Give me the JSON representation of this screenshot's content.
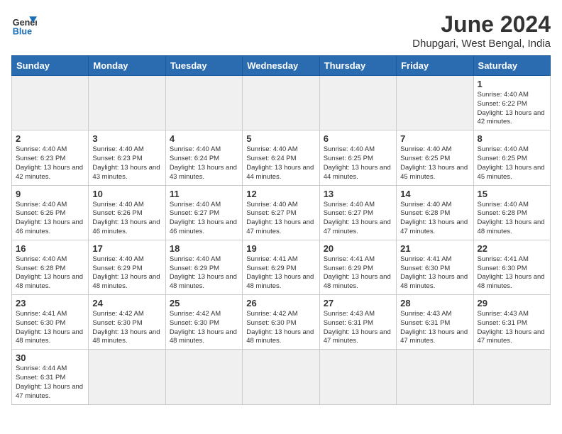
{
  "header": {
    "logo_general": "General",
    "logo_blue": "Blue",
    "month_title": "June 2024",
    "location": "Dhupgari, West Bengal, India"
  },
  "weekdays": [
    "Sunday",
    "Monday",
    "Tuesday",
    "Wednesday",
    "Thursday",
    "Friday",
    "Saturday"
  ],
  "weeks": [
    [
      {
        "day": "",
        "info": "",
        "empty": true
      },
      {
        "day": "",
        "info": "",
        "empty": true
      },
      {
        "day": "",
        "info": "",
        "empty": true
      },
      {
        "day": "",
        "info": "",
        "empty": true
      },
      {
        "day": "",
        "info": "",
        "empty": true
      },
      {
        "day": "",
        "info": "",
        "empty": true
      },
      {
        "day": "1",
        "info": "Sunrise: 4:40 AM\nSunset: 6:22 PM\nDaylight: 13 hours\nand 42 minutes.",
        "empty": false
      }
    ],
    [
      {
        "day": "2",
        "info": "Sunrise: 4:40 AM\nSunset: 6:23 PM\nDaylight: 13 hours\nand 42 minutes.",
        "empty": false
      },
      {
        "day": "3",
        "info": "Sunrise: 4:40 AM\nSunset: 6:23 PM\nDaylight: 13 hours\nand 43 minutes.",
        "empty": false
      },
      {
        "day": "4",
        "info": "Sunrise: 4:40 AM\nSunset: 6:24 PM\nDaylight: 13 hours\nand 43 minutes.",
        "empty": false
      },
      {
        "day": "5",
        "info": "Sunrise: 4:40 AM\nSunset: 6:24 PM\nDaylight: 13 hours\nand 44 minutes.",
        "empty": false
      },
      {
        "day": "6",
        "info": "Sunrise: 4:40 AM\nSunset: 6:25 PM\nDaylight: 13 hours\nand 44 minutes.",
        "empty": false
      },
      {
        "day": "7",
        "info": "Sunrise: 4:40 AM\nSunset: 6:25 PM\nDaylight: 13 hours\nand 45 minutes.",
        "empty": false
      },
      {
        "day": "8",
        "info": "Sunrise: 4:40 AM\nSunset: 6:25 PM\nDaylight: 13 hours\nand 45 minutes.",
        "empty": false
      }
    ],
    [
      {
        "day": "9",
        "info": "Sunrise: 4:40 AM\nSunset: 6:26 PM\nDaylight: 13 hours\nand 46 minutes.",
        "empty": false
      },
      {
        "day": "10",
        "info": "Sunrise: 4:40 AM\nSunset: 6:26 PM\nDaylight: 13 hours\nand 46 minutes.",
        "empty": false
      },
      {
        "day": "11",
        "info": "Sunrise: 4:40 AM\nSunset: 6:27 PM\nDaylight: 13 hours\nand 46 minutes.",
        "empty": false
      },
      {
        "day": "12",
        "info": "Sunrise: 4:40 AM\nSunset: 6:27 PM\nDaylight: 13 hours\nand 47 minutes.",
        "empty": false
      },
      {
        "day": "13",
        "info": "Sunrise: 4:40 AM\nSunset: 6:27 PM\nDaylight: 13 hours\nand 47 minutes.",
        "empty": false
      },
      {
        "day": "14",
        "info": "Sunrise: 4:40 AM\nSunset: 6:28 PM\nDaylight: 13 hours\nand 47 minutes.",
        "empty": false
      },
      {
        "day": "15",
        "info": "Sunrise: 4:40 AM\nSunset: 6:28 PM\nDaylight: 13 hours\nand 48 minutes.",
        "empty": false
      }
    ],
    [
      {
        "day": "16",
        "info": "Sunrise: 4:40 AM\nSunset: 6:28 PM\nDaylight: 13 hours\nand 48 minutes.",
        "empty": false
      },
      {
        "day": "17",
        "info": "Sunrise: 4:40 AM\nSunset: 6:29 PM\nDaylight: 13 hours\nand 48 minutes.",
        "empty": false
      },
      {
        "day": "18",
        "info": "Sunrise: 4:40 AM\nSunset: 6:29 PM\nDaylight: 13 hours\nand 48 minutes.",
        "empty": false
      },
      {
        "day": "19",
        "info": "Sunrise: 4:41 AM\nSunset: 6:29 PM\nDaylight: 13 hours\nand 48 minutes.",
        "empty": false
      },
      {
        "day": "20",
        "info": "Sunrise: 4:41 AM\nSunset: 6:29 PM\nDaylight: 13 hours\nand 48 minutes.",
        "empty": false
      },
      {
        "day": "21",
        "info": "Sunrise: 4:41 AM\nSunset: 6:30 PM\nDaylight: 13 hours\nand 48 minutes.",
        "empty": false
      },
      {
        "day": "22",
        "info": "Sunrise: 4:41 AM\nSunset: 6:30 PM\nDaylight: 13 hours\nand 48 minutes.",
        "empty": false
      }
    ],
    [
      {
        "day": "23",
        "info": "Sunrise: 4:41 AM\nSunset: 6:30 PM\nDaylight: 13 hours\nand 48 minutes.",
        "empty": false
      },
      {
        "day": "24",
        "info": "Sunrise: 4:42 AM\nSunset: 6:30 PM\nDaylight: 13 hours\nand 48 minutes.",
        "empty": false
      },
      {
        "day": "25",
        "info": "Sunrise: 4:42 AM\nSunset: 6:30 PM\nDaylight: 13 hours\nand 48 minutes.",
        "empty": false
      },
      {
        "day": "26",
        "info": "Sunrise: 4:42 AM\nSunset: 6:30 PM\nDaylight: 13 hours\nand 48 minutes.",
        "empty": false
      },
      {
        "day": "27",
        "info": "Sunrise: 4:43 AM\nSunset: 6:31 PM\nDaylight: 13 hours\nand 47 minutes.",
        "empty": false
      },
      {
        "day": "28",
        "info": "Sunrise: 4:43 AM\nSunset: 6:31 PM\nDaylight: 13 hours\nand 47 minutes.",
        "empty": false
      },
      {
        "day": "29",
        "info": "Sunrise: 4:43 AM\nSunset: 6:31 PM\nDaylight: 13 hours\nand 47 minutes.",
        "empty": false
      }
    ],
    [
      {
        "day": "30",
        "info": "Sunrise: 4:44 AM\nSunset: 6:31 PM\nDaylight: 13 hours\nand 47 minutes.",
        "empty": false
      },
      {
        "day": "",
        "info": "",
        "empty": true
      },
      {
        "day": "",
        "info": "",
        "empty": true
      },
      {
        "day": "",
        "info": "",
        "empty": true
      },
      {
        "day": "",
        "info": "",
        "empty": true
      },
      {
        "day": "",
        "info": "",
        "empty": true
      },
      {
        "day": "",
        "info": "",
        "empty": true
      }
    ]
  ]
}
